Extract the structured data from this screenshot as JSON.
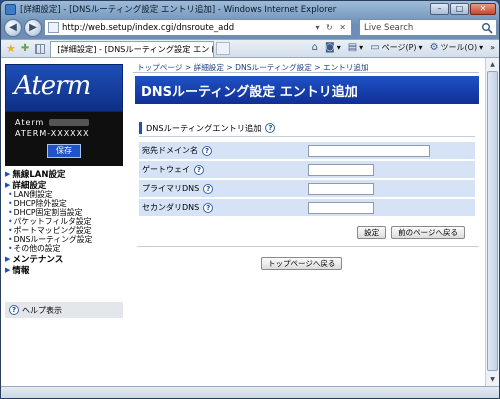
{
  "window": {
    "title": "[詳細設定] - [DNSルーティング設定 エントリ追加] - Windows Internet Explorer",
    "minimize": "–",
    "maximize": "□",
    "close": "✕"
  },
  "nav": {
    "back": "◀",
    "forward": "▶",
    "url": "http://web.setup/index.cgi/dnsroute_add",
    "address_tools": "▾ ↻ ✕",
    "search_placeholder": "Live Search"
  },
  "tabs": {
    "active_tab": "[詳細設定] - [DNSルーティング設定 エントリ...",
    "tab_close": "✕"
  },
  "commands": {
    "home": "⌂",
    "feeds": "▾",
    "print": "▾",
    "page": "ページ(P)",
    "tools": "ツール(O)",
    "arrows": "▾",
    "overflow": "»"
  },
  "sidebar": {
    "logo": "Aterm",
    "brand": "Aterm",
    "model": "ATERM-XXXXXX",
    "save_label": "保存",
    "menu": [
      {
        "label": "無線LAN設定"
      },
      {
        "label": "詳細設定",
        "items": [
          "LAN側設定",
          "DHCP除外設定",
          "DHCP固定割当設定",
          "パケットフィルタ設定",
          "ポートマッピング設定",
          "DNSルーティング設定",
          "その他の設定"
        ]
      },
      {
        "label": "メンテナンス"
      },
      {
        "label": "情報"
      }
    ],
    "help_label": "ヘルプ表示"
  },
  "main": {
    "breadcrumb": "トップページ > 詳細設定 > DNSルーティング設定 > エントリ追加",
    "page_title": "DNSルーティング設定 エントリ追加",
    "section_title": "DNSルーティングエントリ追加",
    "fields": [
      {
        "label": "宛先ドメイン名",
        "value": ""
      },
      {
        "label": "ゲートウェイ",
        "value": ""
      },
      {
        "label": "プライマリDNS",
        "value": ""
      },
      {
        "label": "セカンダリDNS",
        "value": ""
      }
    ],
    "set_button": "設定",
    "back_button": "前のページへ戻る",
    "top_button": "トップページへ戻る",
    "help_glyph": "?"
  },
  "status": {
    "text": ""
  }
}
